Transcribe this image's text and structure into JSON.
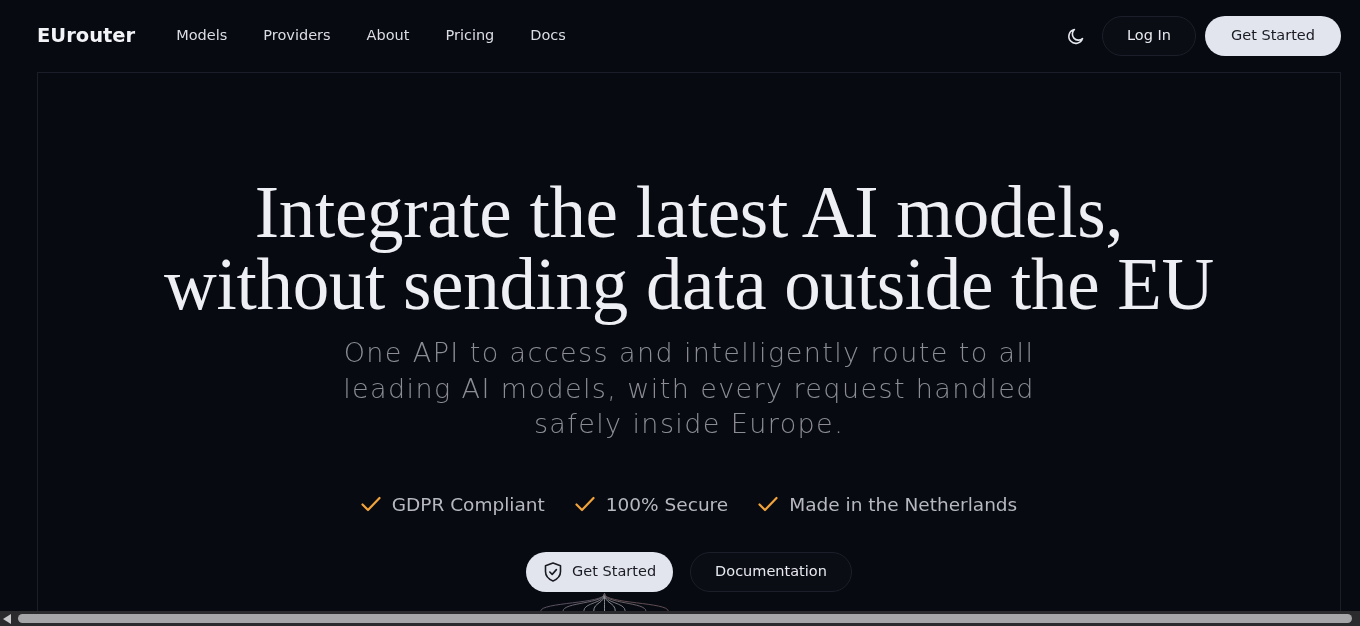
{
  "brand": "EUrouter",
  "nav": {
    "links": [
      "Models",
      "Providers",
      "About",
      "Pricing",
      "Docs"
    ]
  },
  "actions": [
    {
      "kind": "theme"
    },
    {
      "kind": "outline",
      "label": "Log In"
    },
    {
      "kind": "light",
      "label": "Get Started"
    }
  ],
  "hero": {
    "title_lines": [
      "Integrate the latest AI models,",
      "without sending data outside the EU"
    ],
    "subtitle": "One API to access and intelligently route to all leading AI models, with every request handled safely inside Europe.",
    "features": [
      "GDPR Compliant",
      "100% Secure",
      "Made in the Netherlands"
    ],
    "buttons": [
      {
        "kind": "light",
        "label": "Get Started"
      },
      {
        "kind": "outline",
        "label": "Documentation"
      }
    ]
  }
}
